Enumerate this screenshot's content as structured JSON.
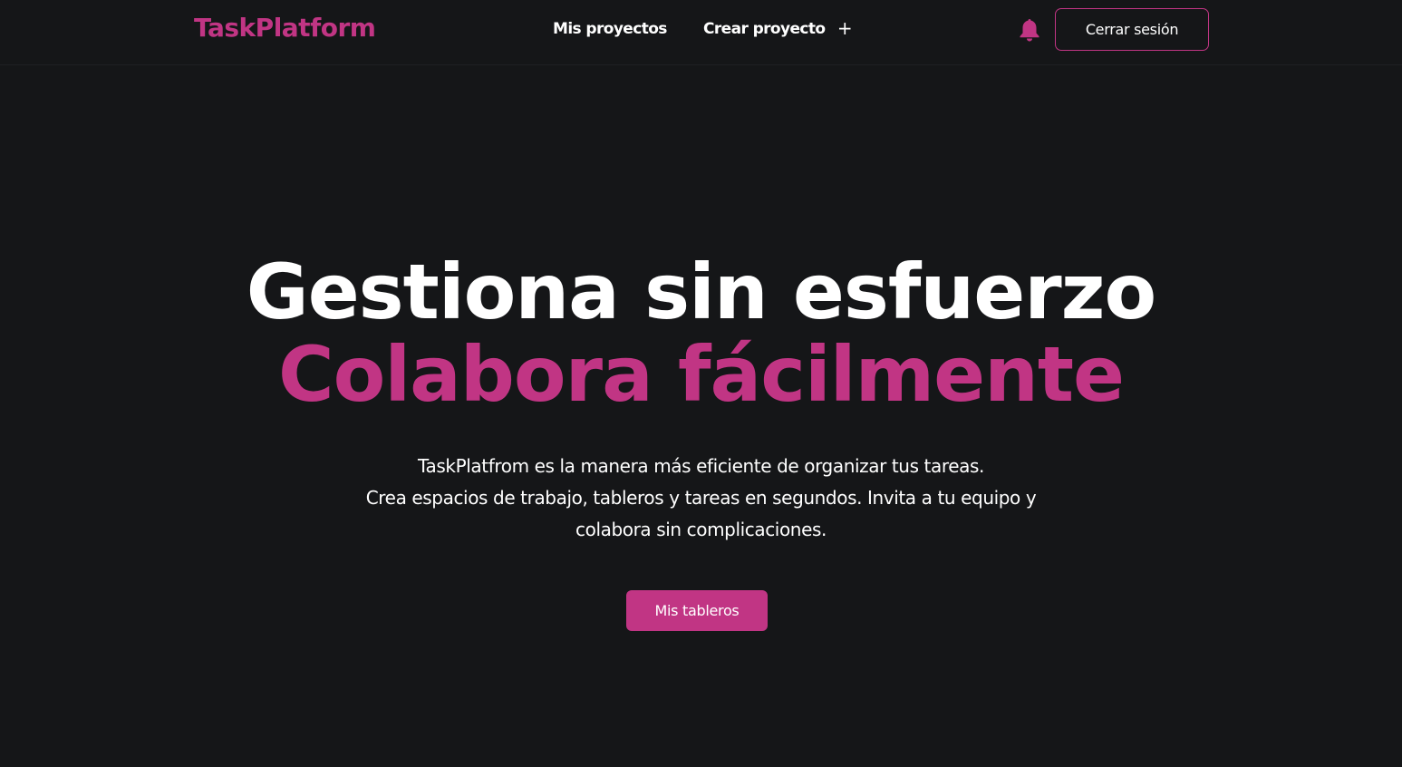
{
  "navbar": {
    "brand": "TaskPlatform",
    "links": [
      {
        "label": "Mis proyectos"
      },
      {
        "label": "Crear proyecto",
        "icon": "plus-icon"
      }
    ],
    "notification_icon": "bell-icon",
    "logout_label": "Cerrar sesión"
  },
  "hero": {
    "title_line1": "Gestiona sin esfuerzo",
    "title_line2": "Colabora fácilmente",
    "description_lines": [
      "TaskPlatfrom es la manera más eficiente de organizar tus tareas.",
      "Crea espacios de trabajo, tableros y tareas en segundos. Invita a tu equipo y",
      "colabora sin complicaciones."
    ],
    "cta_label": "Mis tableros"
  },
  "colors": {
    "background": "#151618",
    "accent": "#c13584",
    "text": "#ffffff"
  }
}
